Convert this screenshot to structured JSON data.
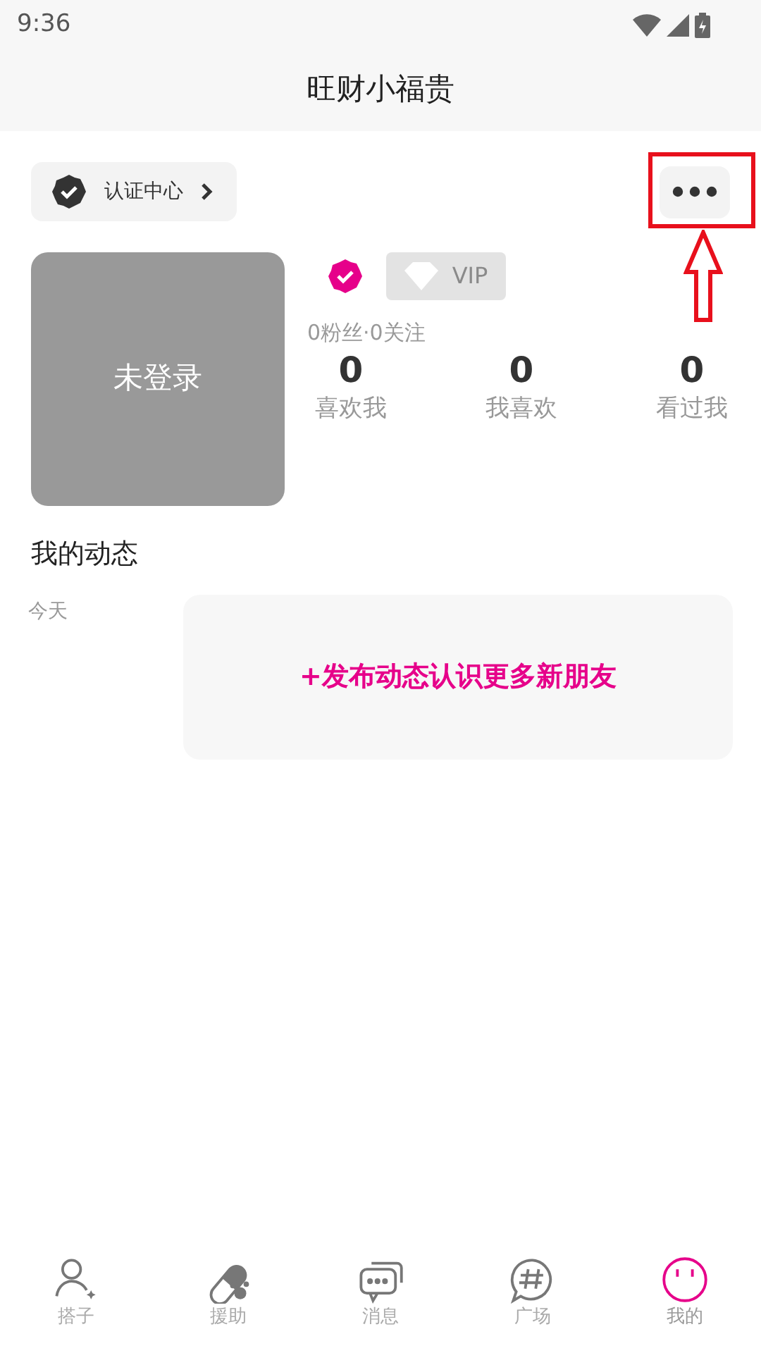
{
  "status_bar": {
    "time": "9:36"
  },
  "header": {
    "title": "旺财小福贵"
  },
  "cert_chip": {
    "label": "认证中心"
  },
  "profile": {
    "avatar_text": "未登录",
    "verified": true,
    "vip_label": "VIP",
    "vip_active": false,
    "follow_summary": "0粉丝·0关注",
    "stats": [
      {
        "value": "0",
        "label": "喜欢我"
      },
      {
        "value": "0",
        "label": "我喜欢"
      },
      {
        "value": "0",
        "label": "看过我"
      }
    ]
  },
  "moments": {
    "title": "我的动态",
    "date": "今天",
    "post_prompt": "+发布动态认识更多新朋友"
  },
  "tab_bar": [
    {
      "label": "搭子",
      "selected": false
    },
    {
      "label": "援助",
      "selected": false
    },
    {
      "label": "消息",
      "selected": false
    },
    {
      "label": "广场",
      "selected": false
    },
    {
      "label": "我的",
      "selected": true
    }
  ]
}
